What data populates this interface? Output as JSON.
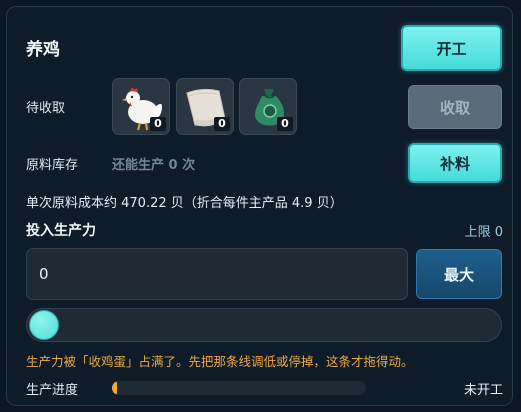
{
  "header": {
    "title": "养鸡",
    "start_label": "开工"
  },
  "pending": {
    "label": "待收取",
    "items": [
      {
        "icon": "chicken-icon",
        "count": "0"
      },
      {
        "icon": "paper-icon",
        "count": "0"
      },
      {
        "icon": "money-bag-icon",
        "count": "0"
      }
    ],
    "collect_label": "收取"
  },
  "stock": {
    "label": "原料库存",
    "note": "还能生产 0 次",
    "refill_label": "补料"
  },
  "cost_line": "单次原料成本约 470.22 贝（折合每件主产品 4.9 贝）",
  "input_section": {
    "title": "投入生产力",
    "limit": "上限 0",
    "value": "0",
    "max_label": "最大",
    "slider_value": 0
  },
  "warning": "生产力被「收鸡蛋」占满了。先把那条线调低或停掉，这条才拖得动。",
  "progress": {
    "label": "生产进度",
    "fraction": 0.02,
    "status": "未开工"
  },
  "colors": {
    "accent": "#4fdad6",
    "warning": "#f0a63a",
    "progress": "#f2a93b"
  }
}
